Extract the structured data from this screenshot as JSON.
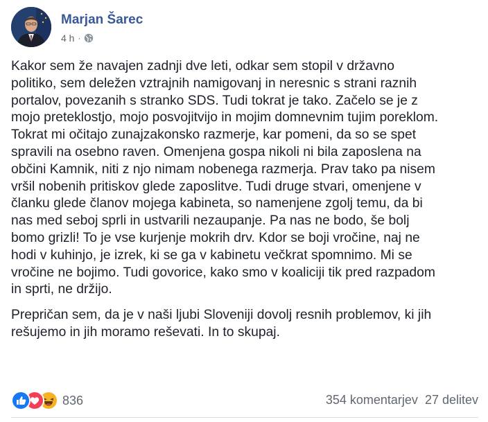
{
  "post": {
    "author": "Marjan Šarec",
    "time": "4 h",
    "separator": "·",
    "privacy_icon": "globe-icon",
    "paragraphs": [
      {
        "lines": [
          "Kakor sem že navajen zadnji dve leti, odkar sem stopil v državno",
          "politiko, sem deležen vztrajnih namigovanj in neresnic s strani raznih",
          "portalov, povezanih s stranko SDS. Tudi tokrat je tako. Začelo se je z",
          "mojo preteklostjo, mojo posvojitvijo in mojim domnevnim tujim poreklom.",
          "Tokrat mi očitajo zunajzakonsko razmerje, kar pomeni, da so se spet",
          "spravili na osebno raven. Omenjena gospa nikoli ni bila zaposlena na",
          "občini Kamnik, niti z njo nimam nobenega razmerja. Prav tako pa nisem",
          "vršil nobenih pritiskov glede zaposlitve. Tudi druge stvari, omenjene v",
          "članku glede članov mojega kabineta, so namenjene zgolj temu, da bi",
          "nas med seboj sprli in ustvarili nezaupanje. Pa nas ne bodo, še bolj",
          "bomo grizli! To je vse kurjenje mokrih drv. Kdor se boji vročine, naj ne",
          "hodi v kuhinjo, je izrek, ki se ga v kabinetu večkrat spomnimo. Mi se",
          "vročine ne bojimo. Tudi govorice, kako smo v koaliciji tik pred razpadom",
          "in sprti, ne držijo."
        ]
      },
      {
        "lines": [
          "Prepričan sem, da je v naši ljubi Sloveniji dovolj resnih problemov, ki jih",
          "rešujemo in jih moramo reševati. In to skupaj."
        ]
      }
    ],
    "reactions": {
      "icons": [
        "like-icon",
        "love-icon",
        "haha-icon"
      ],
      "count": "836"
    },
    "comments": "354 komentarjev",
    "shares": "27 delitev",
    "colors": {
      "author": "#385898",
      "meta": "#616770",
      "text": "#1d2129",
      "like": "#1877f2",
      "love": "#f33e58",
      "haha": "#f7b125"
    }
  }
}
